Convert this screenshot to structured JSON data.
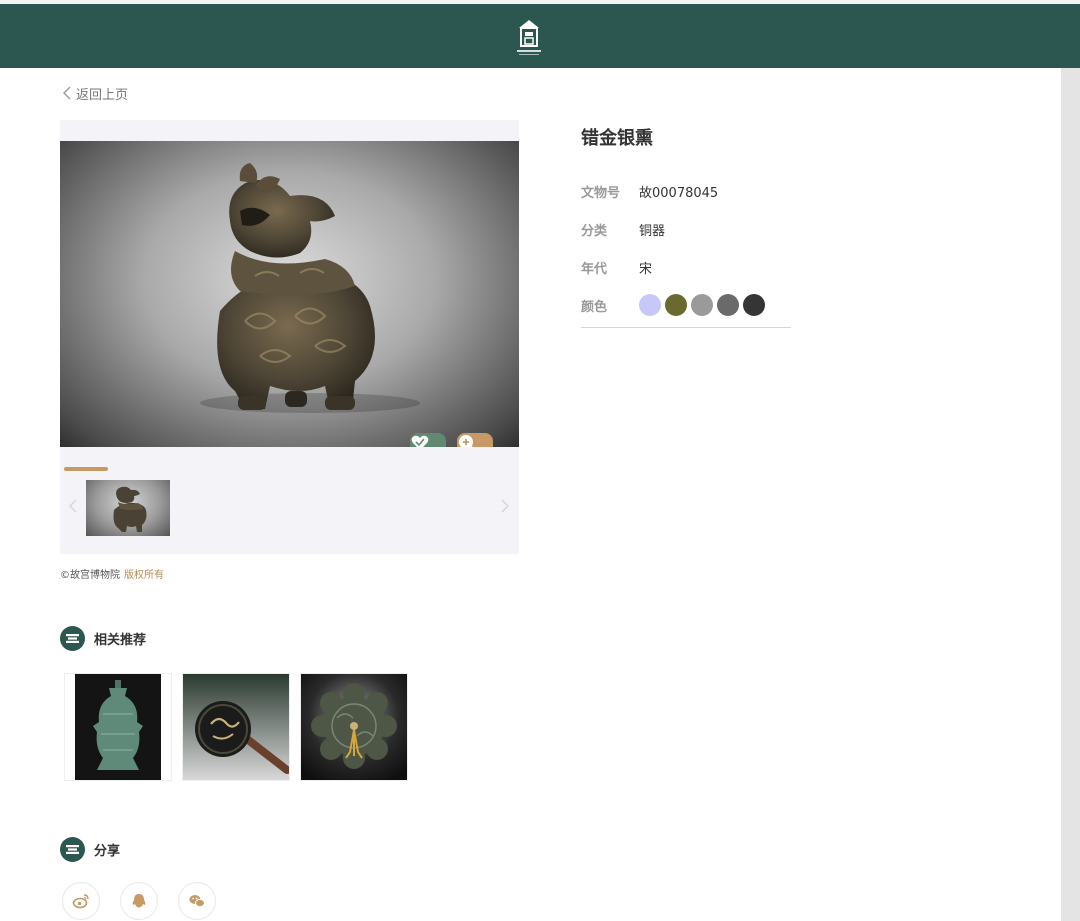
{
  "header": {
    "logo_icon": "palace-museum-logo-icon",
    "bg_color": "#2c5650"
  },
  "nav": {
    "back_label": "返回上页"
  },
  "artifact": {
    "title": "错金银熏",
    "fields": [
      {
        "label": "文物号",
        "value": "故00078045"
      },
      {
        "label": "分类",
        "value": "铜器"
      },
      {
        "label": "年代",
        "value": "宋"
      }
    ],
    "color_label": "颜色",
    "colors": [
      "#c8c8f8",
      "#6b6a2e",
      "#9a9a9a",
      "#6a6a6a",
      "#353535"
    ]
  },
  "viewer": {
    "favorite_icon": "heart-icon",
    "zoom_icon": "zoom-in-icon",
    "accent_color": "#c79a65"
  },
  "copyright": {
    "owner": "©故宫博物院",
    "link_label": "版权所有"
  },
  "related": {
    "heading": "相关推荐",
    "items": [
      "bronze-vessel",
      "bronze-mirror-handle",
      "bronze-lobed-mirror"
    ]
  },
  "share": {
    "heading": "分享",
    "icons": [
      "weibo-icon",
      "qq-icon",
      "wechat-icon"
    ]
  }
}
